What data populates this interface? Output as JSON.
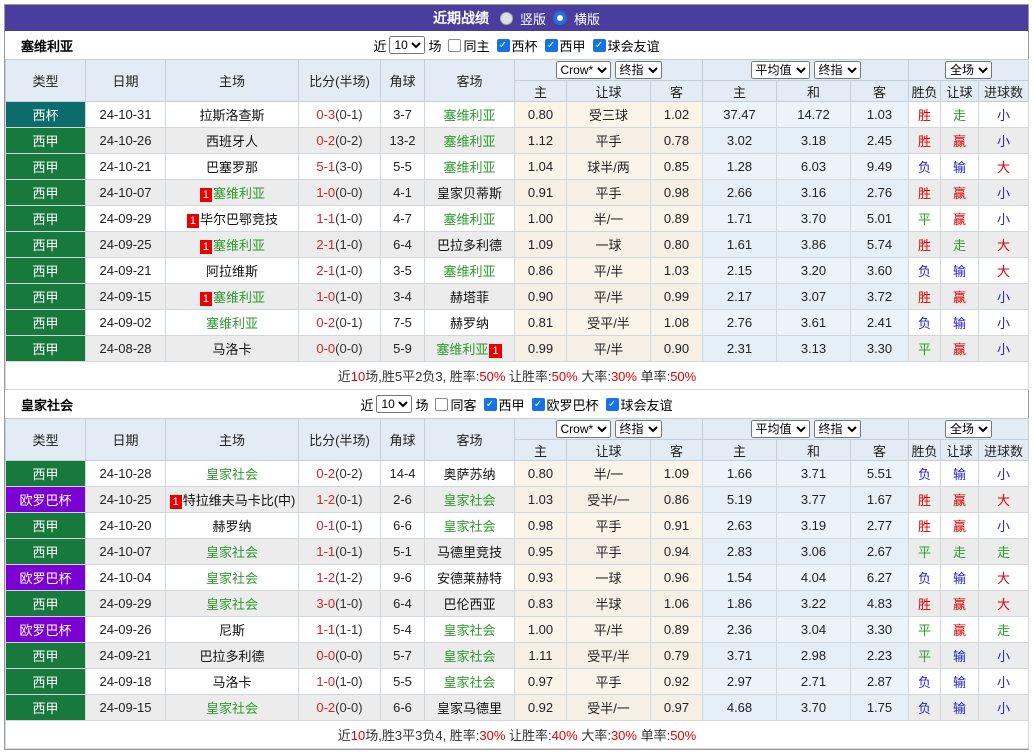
{
  "title_bar": {
    "title": "近期战绩",
    "radio_vertical": "竖版",
    "radio_horizontal": "横版",
    "vertical_selected": false,
    "horizontal_selected": true
  },
  "colors": {
    "title_bar_purple": "#4a3d9e",
    "header_bg": "#e3ecf4",
    "focus_team_green": "#2e9b2e",
    "score_red": "#dd2222",
    "win_red": "#dd0000",
    "draw_green": "#2ba02b",
    "lose_blue": "#2424cc",
    "checkbox_blue": "#1673e6",
    "rank_badge_red": "#e80000"
  },
  "type_colors": {
    "西杯": "#0c6b6b",
    "西甲": "#18793c",
    "欧罗巴杯": "#7b00d2"
  },
  "table_header": {
    "cols": [
      "类型",
      "日期",
      "主场",
      "比分(半场)",
      "角球",
      "客场"
    ],
    "sub": [
      "主",
      "让球",
      "客",
      "主",
      "和",
      "客",
      "胜负",
      "让球",
      "进球数"
    ],
    "selects": {
      "bookmaker": "Crow*",
      "bookmaker_final": "终指",
      "average": "平均值",
      "average_final": "终指",
      "scope": "全场"
    }
  },
  "sections": [
    {
      "team": "塞维利亚",
      "filter": {
        "near": "近",
        "count": "10",
        "unit": "场",
        "same_label": "同主",
        "same_checked": false,
        "competitions": [
          "西杯",
          "西甲",
          "球会友谊"
        ]
      },
      "rows": [
        {
          "comp": "西杯",
          "date": "24-10-31",
          "home": {
            "name": "拉斯洛查斯",
            "focus": false,
            "rank": ""
          },
          "ft": "0-3",
          "ht": "(0-1)",
          "corner": "3-7",
          "away": {
            "name": "塞维利亚",
            "focus": true,
            "rank": ""
          },
          "odds": [
            "0.80",
            "受三球",
            "1.02"
          ],
          "avg": [
            "37.47",
            "14.72",
            "1.03"
          ],
          "results": [
            [
              "胜",
              "r"
            ],
            [
              "走",
              "g"
            ],
            [
              "小",
              "b"
            ]
          ]
        },
        {
          "comp": "西甲",
          "date": "24-10-26",
          "home": {
            "name": "西班牙人",
            "focus": false,
            "rank": ""
          },
          "ft": "0-2",
          "ht": "(0-2)",
          "corner": "13-2",
          "away": {
            "name": "塞维利亚",
            "focus": true,
            "rank": ""
          },
          "odds": [
            "1.12",
            "平手",
            "0.78"
          ],
          "avg": [
            "3.02",
            "3.18",
            "2.45"
          ],
          "results": [
            [
              "胜",
              "r"
            ],
            [
              "赢",
              "r"
            ],
            [
              "小",
              "b"
            ]
          ]
        },
        {
          "comp": "西甲",
          "date": "24-10-21",
          "home": {
            "name": "巴塞罗那",
            "focus": false,
            "rank": ""
          },
          "ft": "5-1",
          "ht": "(3-0)",
          "corner": "5-5",
          "away": {
            "name": "塞维利亚",
            "focus": true,
            "rank": ""
          },
          "odds": [
            "1.04",
            "球半/两",
            "0.85"
          ],
          "avg": [
            "1.28",
            "6.03",
            "9.49"
          ],
          "results": [
            [
              "负",
              "b"
            ],
            [
              "输",
              "b"
            ],
            [
              "大",
              "r"
            ]
          ]
        },
        {
          "comp": "西甲",
          "date": "24-10-07",
          "home": {
            "name": "塞维利亚",
            "focus": true,
            "rank": "1"
          },
          "ft": "1-0",
          "ht": "(0-0)",
          "corner": "4-1",
          "away": {
            "name": "皇家贝蒂斯",
            "focus": false,
            "rank": ""
          },
          "odds": [
            "0.91",
            "平手",
            "0.98"
          ],
          "avg": [
            "2.66",
            "3.16",
            "2.76"
          ],
          "results": [
            [
              "胜",
              "r"
            ],
            [
              "赢",
              "r"
            ],
            [
              "小",
              "b"
            ]
          ]
        },
        {
          "comp": "西甲",
          "date": "24-09-29",
          "home": {
            "name": "毕尔巴鄂竞技",
            "focus": false,
            "rank": "1"
          },
          "ft": "1-1",
          "ht": "(1-0)",
          "corner": "4-7",
          "away": {
            "name": "塞维利亚",
            "focus": true,
            "rank": ""
          },
          "odds": [
            "1.00",
            "半/一",
            "0.89"
          ],
          "avg": [
            "1.71",
            "3.70",
            "5.01"
          ],
          "results": [
            [
              "平",
              "g"
            ],
            [
              "赢",
              "r"
            ],
            [
              "小",
              "b"
            ]
          ]
        },
        {
          "comp": "西甲",
          "date": "24-09-25",
          "home": {
            "name": "塞维利亚",
            "focus": true,
            "rank": "1"
          },
          "ft": "2-1",
          "ht": "(1-0)",
          "corner": "6-4",
          "away": {
            "name": "巴拉多利德",
            "focus": false,
            "rank": ""
          },
          "odds": [
            "1.09",
            "一球",
            "0.80"
          ],
          "avg": [
            "1.61",
            "3.86",
            "5.74"
          ],
          "results": [
            [
              "胜",
              "r"
            ],
            [
              "走",
              "g"
            ],
            [
              "大",
              "r"
            ]
          ]
        },
        {
          "comp": "西甲",
          "date": "24-09-21",
          "home": {
            "name": "阿拉维斯",
            "focus": false,
            "rank": ""
          },
          "ft": "2-1",
          "ht": "(1-0)",
          "corner": "3-5",
          "away": {
            "name": "塞维利亚",
            "focus": true,
            "rank": ""
          },
          "odds": [
            "0.86",
            "平/半",
            "1.03"
          ],
          "avg": [
            "2.15",
            "3.20",
            "3.60"
          ],
          "results": [
            [
              "负",
              "b"
            ],
            [
              "输",
              "b"
            ],
            [
              "大",
              "r"
            ]
          ]
        },
        {
          "comp": "西甲",
          "date": "24-09-15",
          "home": {
            "name": "塞维利亚",
            "focus": true,
            "rank": "1"
          },
          "ft": "1-0",
          "ht": "(1-0)",
          "corner": "3-4",
          "away": {
            "name": "赫塔菲",
            "focus": false,
            "rank": ""
          },
          "odds": [
            "0.90",
            "平/半",
            "0.99"
          ],
          "avg": [
            "2.17",
            "3.07",
            "3.72"
          ],
          "results": [
            [
              "胜",
              "r"
            ],
            [
              "赢",
              "r"
            ],
            [
              "小",
              "b"
            ]
          ]
        },
        {
          "comp": "西甲",
          "date": "24-09-02",
          "home": {
            "name": "塞维利亚",
            "focus": true,
            "rank": ""
          },
          "ft": "0-2",
          "ht": "(0-1)",
          "corner": "7-5",
          "away": {
            "name": "赫罗纳",
            "focus": false,
            "rank": ""
          },
          "odds": [
            "0.81",
            "受平/半",
            "1.08"
          ],
          "avg": [
            "2.76",
            "3.61",
            "2.41"
          ],
          "results": [
            [
              "负",
              "b"
            ],
            [
              "输",
              "b"
            ],
            [
              "小",
              "b"
            ]
          ]
        },
        {
          "comp": "西甲",
          "date": "24-08-28",
          "home": {
            "name": "马洛卡",
            "focus": false,
            "rank": ""
          },
          "ft": "0-0",
          "ht": "(0-0)",
          "corner": "5-9",
          "away": {
            "name": "塞维利亚",
            "focus": true,
            "rank": "1"
          },
          "odds": [
            "0.99",
            "平/半",
            "0.90"
          ],
          "avg": [
            "2.31",
            "3.13",
            "3.30"
          ],
          "results": [
            [
              "平",
              "g"
            ],
            [
              "赢",
              "r"
            ],
            [
              "小",
              "b"
            ]
          ]
        }
      ],
      "summary": [
        [
          "近",
          "d"
        ],
        [
          "10",
          "r"
        ],
        [
          "场,胜5平2负3, 胜率:",
          "d"
        ],
        [
          "50%",
          "r"
        ],
        [
          " 让胜率:",
          "d"
        ],
        [
          "50%",
          "r"
        ],
        [
          " 大率:",
          "d"
        ],
        [
          "30%",
          "r"
        ],
        [
          " 单率:",
          "d"
        ],
        [
          "50%",
          "r"
        ]
      ]
    },
    {
      "team": "皇家社会",
      "filter": {
        "near": "近",
        "count": "10",
        "unit": "场",
        "same_label": "同客",
        "same_checked": false,
        "competitions": [
          "西甲",
          "欧罗巴杯",
          "球会友谊"
        ]
      },
      "rows": [
        {
          "comp": "西甲",
          "date": "24-10-28",
          "home": {
            "name": "皇家社会",
            "focus": true,
            "rank": ""
          },
          "ft": "0-2",
          "ht": "(0-2)",
          "corner": "14-4",
          "away": {
            "name": "奥萨苏纳",
            "focus": false,
            "rank": ""
          },
          "odds": [
            "0.80",
            "半/一",
            "1.09"
          ],
          "avg": [
            "1.66",
            "3.71",
            "5.51"
          ],
          "results": [
            [
              "负",
              "b"
            ],
            [
              "输",
              "b"
            ],
            [
              "小",
              "b"
            ]
          ]
        },
        {
          "comp": "欧罗巴杯",
          "date": "24-10-25",
          "home": {
            "name": "特拉维夫马卡比(中)",
            "focus": false,
            "rank": "1"
          },
          "ft": "1-2",
          "ht": "(0-1)",
          "corner": "2-6",
          "away": {
            "name": "皇家社会",
            "focus": true,
            "rank": ""
          },
          "odds": [
            "1.03",
            "受半/一",
            "0.86"
          ],
          "avg": [
            "5.19",
            "3.77",
            "1.67"
          ],
          "results": [
            [
              "胜",
              "r"
            ],
            [
              "赢",
              "r"
            ],
            [
              "大",
              "r"
            ]
          ]
        },
        {
          "comp": "西甲",
          "date": "24-10-20",
          "home": {
            "name": "赫罗纳",
            "focus": false,
            "rank": ""
          },
          "ft": "0-1",
          "ht": "(0-1)",
          "corner": "6-6",
          "away": {
            "name": "皇家社会",
            "focus": true,
            "rank": ""
          },
          "odds": [
            "0.98",
            "平手",
            "0.91"
          ],
          "avg": [
            "2.63",
            "3.19",
            "2.77"
          ],
          "results": [
            [
              "胜",
              "r"
            ],
            [
              "赢",
              "r"
            ],
            [
              "小",
              "b"
            ]
          ]
        },
        {
          "comp": "西甲",
          "date": "24-10-07",
          "home": {
            "name": "皇家社会",
            "focus": true,
            "rank": ""
          },
          "ft": "1-1",
          "ht": "(0-1)",
          "corner": "5-1",
          "away": {
            "name": "马德里竞技",
            "focus": false,
            "rank": ""
          },
          "odds": [
            "0.95",
            "平手",
            "0.94"
          ],
          "avg": [
            "2.83",
            "3.06",
            "2.67"
          ],
          "results": [
            [
              "平",
              "g"
            ],
            [
              "走",
              "g"
            ],
            [
              "走",
              "g"
            ]
          ]
        },
        {
          "comp": "欧罗巴杯",
          "date": "24-10-04",
          "home": {
            "name": "皇家社会",
            "focus": true,
            "rank": ""
          },
          "ft": "1-2",
          "ht": "(1-2)",
          "corner": "9-6",
          "away": {
            "name": "安德莱赫特",
            "focus": false,
            "rank": ""
          },
          "odds": [
            "0.93",
            "一球",
            "0.96"
          ],
          "avg": [
            "1.54",
            "4.04",
            "6.27"
          ],
          "results": [
            [
              "负",
              "b"
            ],
            [
              "输",
              "b"
            ],
            [
              "大",
              "r"
            ]
          ]
        },
        {
          "comp": "西甲",
          "date": "24-09-29",
          "home": {
            "name": "皇家社会",
            "focus": true,
            "rank": ""
          },
          "ft": "3-0",
          "ht": "(1-0)",
          "corner": "6-4",
          "away": {
            "name": "巴伦西亚",
            "focus": false,
            "rank": ""
          },
          "odds": [
            "0.83",
            "半球",
            "1.06"
          ],
          "avg": [
            "1.86",
            "3.22",
            "4.83"
          ],
          "results": [
            [
              "胜",
              "r"
            ],
            [
              "赢",
              "r"
            ],
            [
              "大",
              "r"
            ]
          ]
        },
        {
          "comp": "欧罗巴杯",
          "date": "24-09-26",
          "home": {
            "name": "尼斯",
            "focus": false,
            "rank": ""
          },
          "ft": "1-1",
          "ht": "(1-1)",
          "corner": "5-4",
          "away": {
            "name": "皇家社会",
            "focus": true,
            "rank": ""
          },
          "odds": [
            "1.00",
            "平/半",
            "0.89"
          ],
          "avg": [
            "2.36",
            "3.04",
            "3.30"
          ],
          "results": [
            [
              "平",
              "g"
            ],
            [
              "赢",
              "r"
            ],
            [
              "走",
              "g"
            ]
          ]
        },
        {
          "comp": "西甲",
          "date": "24-09-21",
          "home": {
            "name": "巴拉多利德",
            "focus": false,
            "rank": ""
          },
          "ft": "0-0",
          "ht": "(0-0)",
          "corner": "5-7",
          "away": {
            "name": "皇家社会",
            "focus": true,
            "rank": ""
          },
          "odds": [
            "1.11",
            "受平/半",
            "0.79"
          ],
          "avg": [
            "3.71",
            "2.98",
            "2.23"
          ],
          "results": [
            [
              "平",
              "g"
            ],
            [
              "输",
              "b"
            ],
            [
              "小",
              "b"
            ]
          ]
        },
        {
          "comp": "西甲",
          "date": "24-09-18",
          "home": {
            "name": "马洛卡",
            "focus": false,
            "rank": ""
          },
          "ft": "1-0",
          "ht": "(1-0)",
          "corner": "5-5",
          "away": {
            "name": "皇家社会",
            "focus": true,
            "rank": ""
          },
          "odds": [
            "0.97",
            "平手",
            "0.92"
          ],
          "avg": [
            "2.97",
            "2.71",
            "2.87"
          ],
          "results": [
            [
              "负",
              "b"
            ],
            [
              "输",
              "b"
            ],
            [
              "小",
              "b"
            ]
          ]
        },
        {
          "comp": "西甲",
          "date": "24-09-15",
          "home": {
            "name": "皇家社会",
            "focus": true,
            "rank": ""
          },
          "ft": "0-2",
          "ht": "(0-0)",
          "corner": "6-6",
          "away": {
            "name": "皇家马德里",
            "focus": false,
            "rank": ""
          },
          "odds": [
            "0.92",
            "受半/一",
            "0.97"
          ],
          "avg": [
            "4.68",
            "3.70",
            "1.75"
          ],
          "results": [
            [
              "负",
              "b"
            ],
            [
              "输",
              "b"
            ],
            [
              "小",
              "b"
            ]
          ]
        }
      ],
      "summary": [
        [
          "近",
          "d"
        ],
        [
          "10",
          "r"
        ],
        [
          "场,胜3平3负4, 胜率:",
          "d"
        ],
        [
          "30%",
          "r"
        ],
        [
          " 让胜率:",
          "d"
        ],
        [
          "40%",
          "r"
        ],
        [
          " 大率:",
          "d"
        ],
        [
          "30%",
          "r"
        ],
        [
          " 单率:",
          "d"
        ],
        [
          "50%",
          "r"
        ]
      ]
    }
  ]
}
